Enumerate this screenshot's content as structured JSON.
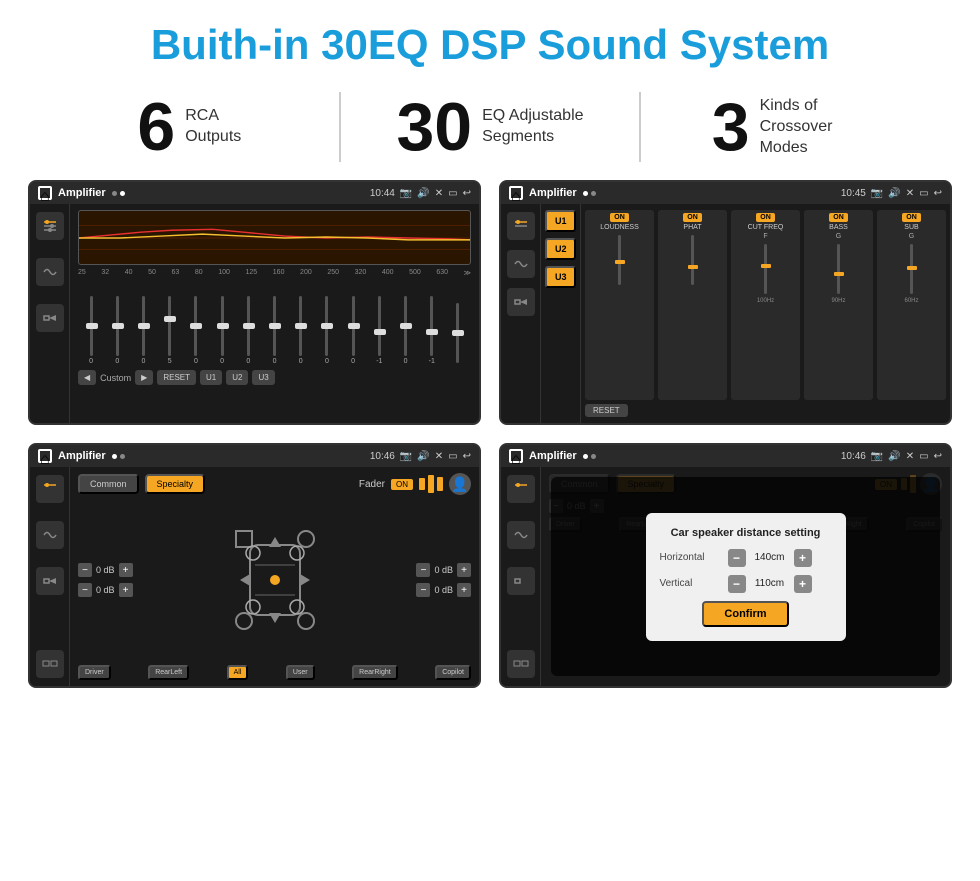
{
  "page": {
    "title": "Buith-in 30EQ DSP Sound System",
    "stats": [
      {
        "number": "6",
        "desc": "RCA\nOutputs"
      },
      {
        "number": "30",
        "desc": "EQ Adjustable\nSegments"
      },
      {
        "number": "3",
        "desc": "Kinds of\nCrossover Modes"
      }
    ]
  },
  "screens": [
    {
      "id": "screen-eq",
      "title": "Amplifier",
      "time": "10:44",
      "type": "eq",
      "freqs": [
        "25",
        "32",
        "40",
        "50",
        "63",
        "80",
        "100",
        "125",
        "160",
        "200",
        "250",
        "320",
        "400",
        "500",
        "630"
      ],
      "values": [
        "0",
        "0",
        "0",
        "5",
        "0",
        "0",
        "0",
        "0",
        "0",
        "0",
        "0",
        "-1",
        "0",
        "-1",
        ""
      ],
      "bottom_buttons": [
        "Custom",
        "RESET",
        "U1",
        "U2",
        "U3"
      ]
    },
    {
      "id": "screen-crossover",
      "title": "Amplifier",
      "time": "10:45",
      "type": "crossover",
      "u_labels": [
        "U1",
        "U2",
        "U3"
      ],
      "modules": [
        "LOUDNESS",
        "PHAT",
        "CUT FREQ",
        "BASS",
        "SUB"
      ],
      "reset_label": "RESET"
    },
    {
      "id": "screen-fader",
      "title": "Amplifier",
      "time": "10:46",
      "type": "fader",
      "tabs": [
        "Common",
        "Specialty"
      ],
      "fader_label": "Fader",
      "car_labels": [
        "Driver",
        "RearLeft",
        "All",
        "User",
        "RearRight",
        "Copilot"
      ],
      "db_values": [
        "0 dB",
        "0 dB",
        "0 dB",
        "0 dB"
      ]
    },
    {
      "id": "screen-distance",
      "title": "Amplifier",
      "time": "10:46",
      "type": "distance",
      "tabs": [
        "Common",
        "Specialty"
      ],
      "modal": {
        "title": "Car speaker distance setting",
        "horizontal_label": "Horizontal",
        "horizontal_value": "140cm",
        "vertical_label": "Vertical",
        "vertical_value": "110cm",
        "confirm_label": "Confirm"
      },
      "car_labels": [
        "Driver",
        "RearLeft",
        "All",
        "User",
        "RearRight",
        "Copilot"
      ]
    }
  ],
  "icons": {
    "home": "⌂",
    "back": "↩",
    "play": "▶",
    "prev": "◀",
    "eq": "≋",
    "wave": "∿",
    "speaker": "◈",
    "expand": "≫",
    "pin": "📍",
    "vol": "🔊",
    "minus": "−",
    "plus": "+",
    "up": "▲",
    "down": "▼",
    "left": "◀",
    "right": "▶"
  }
}
